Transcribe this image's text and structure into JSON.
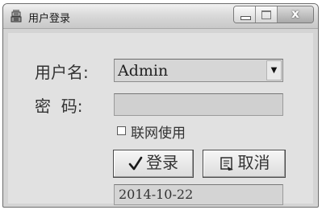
{
  "window": {
    "title": "用户登录",
    "controls": [
      "minimize",
      "maximize",
      "close"
    ],
    "close_glyph": "x"
  },
  "form": {
    "username_label": "用户名:",
    "username_value": "Admin",
    "password_label": "密  码:",
    "password_value": "",
    "network_checkbox_label": "联网使用",
    "network_checked": false,
    "login_button_label": "登录",
    "cancel_button_label": "取消",
    "date": "2014-10-22"
  },
  "icons": {
    "login_button": "checkmark-icon",
    "cancel_button": "cancel-icon",
    "app": "app-icon",
    "combo_arrow": "chevron-down-icon"
  }
}
